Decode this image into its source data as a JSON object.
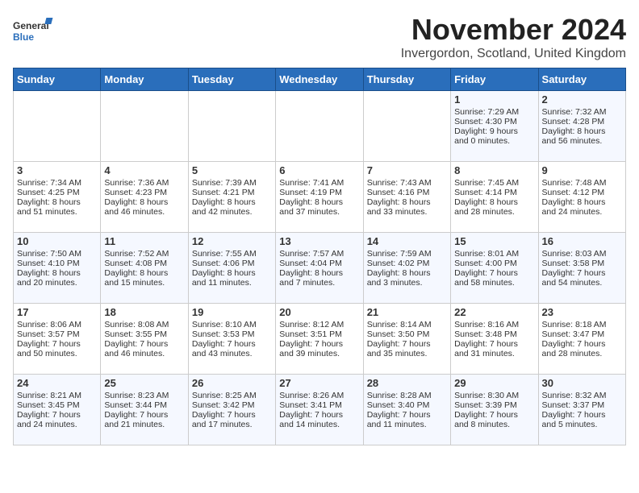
{
  "logo": {
    "general": "General",
    "blue": "Blue"
  },
  "header": {
    "month": "November 2024",
    "location": "Invergordon, Scotland, United Kingdom"
  },
  "days_of_week": [
    "Sunday",
    "Monday",
    "Tuesday",
    "Wednesday",
    "Thursday",
    "Friday",
    "Saturday"
  ],
  "weeks": [
    [
      {
        "day": "",
        "info": ""
      },
      {
        "day": "",
        "info": ""
      },
      {
        "day": "",
        "info": ""
      },
      {
        "day": "",
        "info": ""
      },
      {
        "day": "",
        "info": ""
      },
      {
        "day": "1",
        "info": "Sunrise: 7:29 AM\nSunset: 4:30 PM\nDaylight: 9 hours\nand 0 minutes."
      },
      {
        "day": "2",
        "info": "Sunrise: 7:32 AM\nSunset: 4:28 PM\nDaylight: 8 hours\nand 56 minutes."
      }
    ],
    [
      {
        "day": "3",
        "info": "Sunrise: 7:34 AM\nSunset: 4:25 PM\nDaylight: 8 hours\nand 51 minutes."
      },
      {
        "day": "4",
        "info": "Sunrise: 7:36 AM\nSunset: 4:23 PM\nDaylight: 8 hours\nand 46 minutes."
      },
      {
        "day": "5",
        "info": "Sunrise: 7:39 AM\nSunset: 4:21 PM\nDaylight: 8 hours\nand 42 minutes."
      },
      {
        "day": "6",
        "info": "Sunrise: 7:41 AM\nSunset: 4:19 PM\nDaylight: 8 hours\nand 37 minutes."
      },
      {
        "day": "7",
        "info": "Sunrise: 7:43 AM\nSunset: 4:16 PM\nDaylight: 8 hours\nand 33 minutes."
      },
      {
        "day": "8",
        "info": "Sunrise: 7:45 AM\nSunset: 4:14 PM\nDaylight: 8 hours\nand 28 minutes."
      },
      {
        "day": "9",
        "info": "Sunrise: 7:48 AM\nSunset: 4:12 PM\nDaylight: 8 hours\nand 24 minutes."
      }
    ],
    [
      {
        "day": "10",
        "info": "Sunrise: 7:50 AM\nSunset: 4:10 PM\nDaylight: 8 hours\nand 20 minutes."
      },
      {
        "day": "11",
        "info": "Sunrise: 7:52 AM\nSunset: 4:08 PM\nDaylight: 8 hours\nand 15 minutes."
      },
      {
        "day": "12",
        "info": "Sunrise: 7:55 AM\nSunset: 4:06 PM\nDaylight: 8 hours\nand 11 minutes."
      },
      {
        "day": "13",
        "info": "Sunrise: 7:57 AM\nSunset: 4:04 PM\nDaylight: 8 hours\nand 7 minutes."
      },
      {
        "day": "14",
        "info": "Sunrise: 7:59 AM\nSunset: 4:02 PM\nDaylight: 8 hours\nand 3 minutes."
      },
      {
        "day": "15",
        "info": "Sunrise: 8:01 AM\nSunset: 4:00 PM\nDaylight: 7 hours\nand 58 minutes."
      },
      {
        "day": "16",
        "info": "Sunrise: 8:03 AM\nSunset: 3:58 PM\nDaylight: 7 hours\nand 54 minutes."
      }
    ],
    [
      {
        "day": "17",
        "info": "Sunrise: 8:06 AM\nSunset: 3:57 PM\nDaylight: 7 hours\nand 50 minutes."
      },
      {
        "day": "18",
        "info": "Sunrise: 8:08 AM\nSunset: 3:55 PM\nDaylight: 7 hours\nand 46 minutes."
      },
      {
        "day": "19",
        "info": "Sunrise: 8:10 AM\nSunset: 3:53 PM\nDaylight: 7 hours\nand 43 minutes."
      },
      {
        "day": "20",
        "info": "Sunrise: 8:12 AM\nSunset: 3:51 PM\nDaylight: 7 hours\nand 39 minutes."
      },
      {
        "day": "21",
        "info": "Sunrise: 8:14 AM\nSunset: 3:50 PM\nDaylight: 7 hours\nand 35 minutes."
      },
      {
        "day": "22",
        "info": "Sunrise: 8:16 AM\nSunset: 3:48 PM\nDaylight: 7 hours\nand 31 minutes."
      },
      {
        "day": "23",
        "info": "Sunrise: 8:18 AM\nSunset: 3:47 PM\nDaylight: 7 hours\nand 28 minutes."
      }
    ],
    [
      {
        "day": "24",
        "info": "Sunrise: 8:21 AM\nSunset: 3:45 PM\nDaylight: 7 hours\nand 24 minutes."
      },
      {
        "day": "25",
        "info": "Sunrise: 8:23 AM\nSunset: 3:44 PM\nDaylight: 7 hours\nand 21 minutes."
      },
      {
        "day": "26",
        "info": "Sunrise: 8:25 AM\nSunset: 3:42 PM\nDaylight: 7 hours\nand 17 minutes."
      },
      {
        "day": "27",
        "info": "Sunrise: 8:26 AM\nSunset: 3:41 PM\nDaylight: 7 hours\nand 14 minutes."
      },
      {
        "day": "28",
        "info": "Sunrise: 8:28 AM\nSunset: 3:40 PM\nDaylight: 7 hours\nand 11 minutes."
      },
      {
        "day": "29",
        "info": "Sunrise: 8:30 AM\nSunset: 3:39 PM\nDaylight: 7 hours\nand 8 minutes."
      },
      {
        "day": "30",
        "info": "Sunrise: 8:32 AM\nSunset: 3:37 PM\nDaylight: 7 hours\nand 5 minutes."
      }
    ]
  ]
}
